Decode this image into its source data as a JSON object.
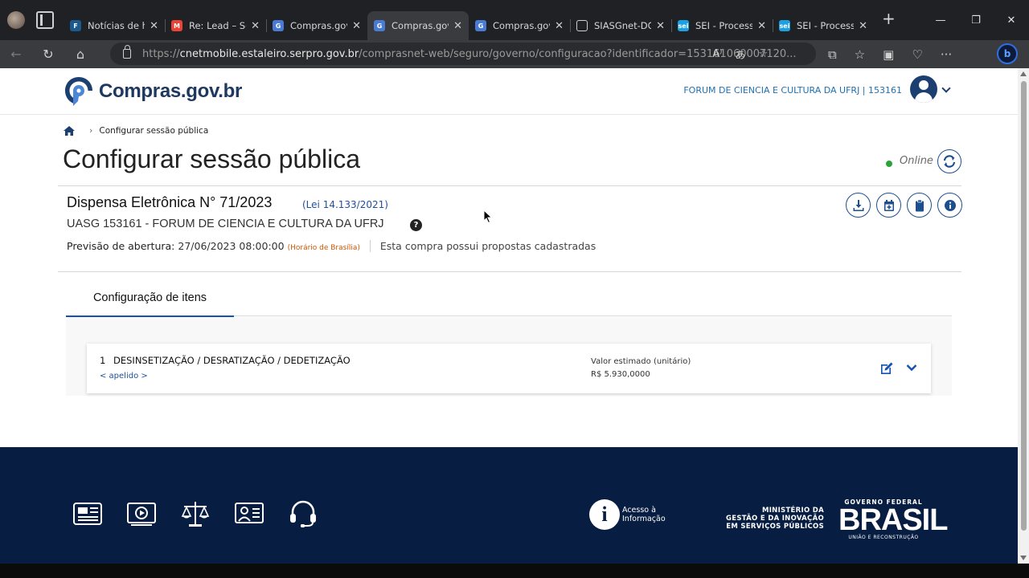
{
  "browser": {
    "tabs": [
      {
        "title": "Notícias de h",
        "fav_color": "#1a5a8f",
        "fav_glyph": "F"
      },
      {
        "title": "Re: Lead – Sc",
        "fav_color": "#ea4335",
        "fav_glyph": "M"
      },
      {
        "title": "Compras.gov",
        "fav_color": "#4a7bd4",
        "fav_glyph": "G"
      },
      {
        "title": "Compras.gov",
        "fav_color": "#4a7bd4",
        "fav_glyph": "G",
        "active": true
      },
      {
        "title": "Compras.gov",
        "fav_color": "#4a7bd4",
        "fav_glyph": "G"
      },
      {
        "title": "SIASGnet-DC",
        "fav_color": "#ffffff",
        "fav_glyph": ""
      },
      {
        "title": "SEI - Process",
        "fav_color": "#1ba1e2",
        "fav_glyph": "sei"
      },
      {
        "title": "SEI - Process",
        "fav_color": "#1ba1e2",
        "fav_glyph": "sei"
      }
    ],
    "url_prefix": "https://",
    "url_host": "cnetmobile.estaleiro.serpro.gov.br",
    "url_path": "/comprasnet-web/seguro/governo/configuracao?identificador=153161060007120..."
  },
  "header": {
    "logo_text": "Compras.gov.br",
    "org": "FORUM DE CIENCIA E CULTURA DA UFRJ | 153161"
  },
  "breadcrumb": {
    "current": "Configurar sessão pública"
  },
  "page": {
    "title": "Configurar sessão pública",
    "status": "Online"
  },
  "compra": {
    "title": "Dispensa Eletrônica N° 71/2023",
    "lei": "(Lei 14.133/2021)",
    "uasg": "UASG 153161 - FORUM DE CIENCIA E CULTURA DA UFRJ",
    "previsao_label": "Previsão de abertura:",
    "previsao_value": "27/06/2023 08:00:00",
    "horario": "(Horário de Brasília)",
    "note": "Esta compra possui propostas cadastradas"
  },
  "tabs": {
    "config": "Configuração de itens"
  },
  "item": {
    "number": "1",
    "name": "DESINSETIZAÇÃO / DESRATIZAÇÃO / DEDETIZAÇÃO",
    "apelido": "< apelido >",
    "valor_label": "Valor estimado (unitário)",
    "valor": "R$ 5.930,0000"
  },
  "footer": {
    "acesso": "Acesso à Informação",
    "ministerio_1": "MINISTÉRIO DA",
    "ministerio_2": "GESTÃO E DA INOVAÇÃO",
    "ministerio_3": "EM SERVIÇOS PÚBLICOS",
    "gov_federal": "GOVERNO FEDERAL",
    "brasil": "BRASIL",
    "uniao": "UNIÃO E RECONSTRUÇÃO"
  },
  "colors": {
    "brand_dark": "#1c3f72",
    "link_blue": "#1351b4",
    "footer_bg": "#071d41",
    "online_green": "#2aa33b"
  }
}
